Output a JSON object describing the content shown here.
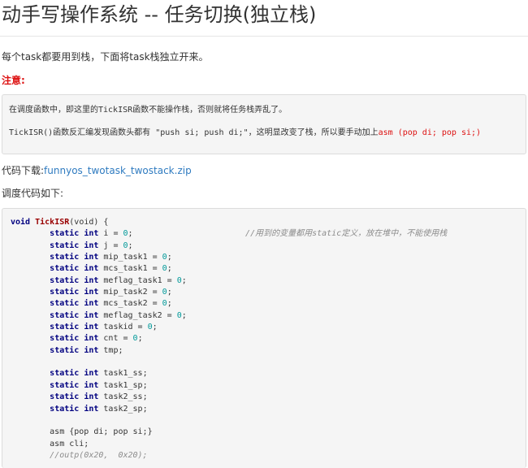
{
  "title": "动手写操作系统 -- 任务切换(独立栈)",
  "intro": "每个task都要用到栈，下面将task栈独立开来。",
  "note": {
    "label": "注意:",
    "line1": "在调度函数中，即这里的TickISR函数不能操作栈，否则就将任务栈弄乱了。",
    "line2_prefix": "TickISR()函数反汇编发现函数头都有 \"push si; push di;\"，这明显改变了栈，所以要手动加上",
    "line2_code": "asm (pop di; pop si;)"
  },
  "download": {
    "label": "代码下载:",
    "link_text": "funnyos_twotask_twostack.zip"
  },
  "code_intro": "调度代码如下:",
  "code": {
    "l1_kw": "void",
    "l1_fn": "TickISR",
    "l1_rest": "(void) {",
    "kw_static": "static",
    "kw_int": "int",
    "decls": [
      {
        "name": "i",
        "init": "0"
      },
      {
        "name": "j",
        "init": "0"
      },
      {
        "name": "mip_task1",
        "init": "0"
      },
      {
        "name": "mcs_task1",
        "init": "0"
      },
      {
        "name": "meflag_task1",
        "init": "0"
      },
      {
        "name": "mip_task2",
        "init": "0"
      },
      {
        "name": "mcs_task2",
        "init": "0"
      },
      {
        "name": "meflag_task2",
        "init": "0"
      },
      {
        "name": "taskid",
        "init": "0"
      },
      {
        "name": "cnt",
        "init": "0"
      }
    ],
    "comment_i": "//用到的变量都用static定义，放在堆中，不能使用栈",
    "tmp_name": "tmp",
    "task_decls": [
      "task1_ss",
      "task1_sp",
      "task2_ss",
      "task2_sp"
    ],
    "asm1": "asm {pop di; pop si;}",
    "asm2": "asm cli;",
    "comment_last": "//outp(0x20,  0x20);"
  }
}
